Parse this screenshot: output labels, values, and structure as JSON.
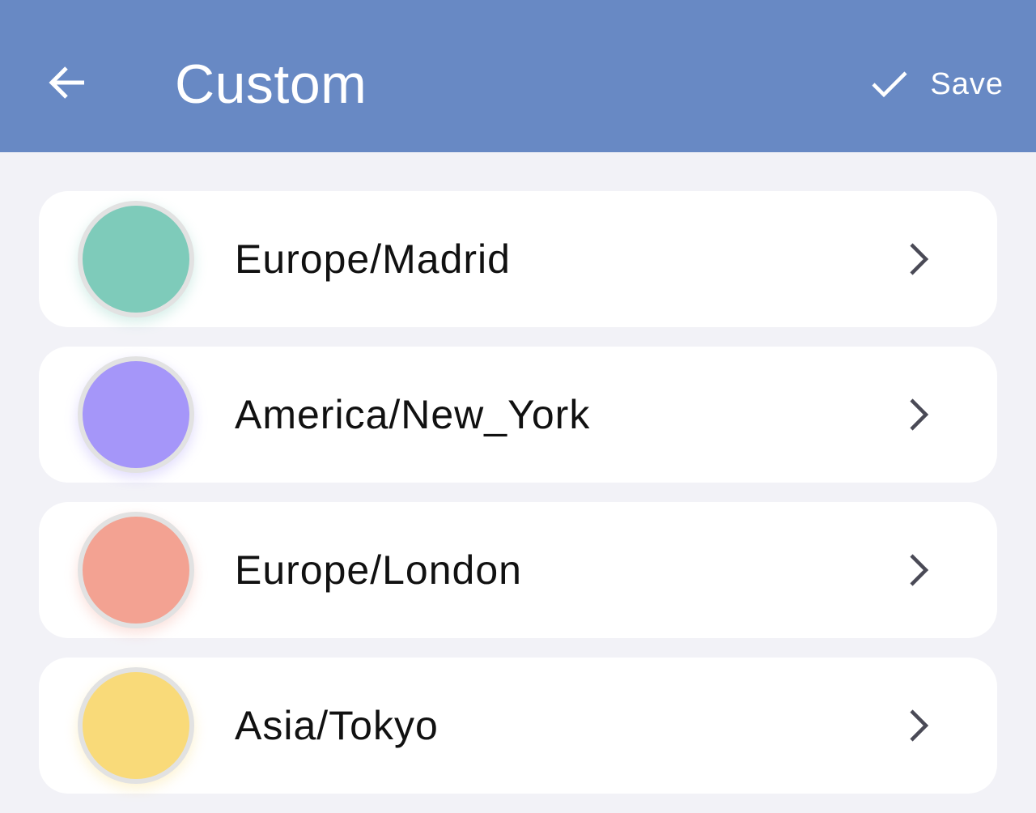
{
  "app_bar": {
    "title": "Custom",
    "back_icon": "arrow-left-icon",
    "save_icon": "check-icon",
    "save_label": "Save",
    "background": "#6889c4"
  },
  "timezones": [
    {
      "name": "Europe/Madrid",
      "color": "#7ecbba"
    },
    {
      "name": "America/New_York",
      "color": "#a596f9"
    },
    {
      "name": "Europe/London",
      "color": "#f3a292"
    },
    {
      "name": "Asia/Tokyo",
      "color": "#f9da79"
    }
  ],
  "row_icon": "chevron-right-icon"
}
